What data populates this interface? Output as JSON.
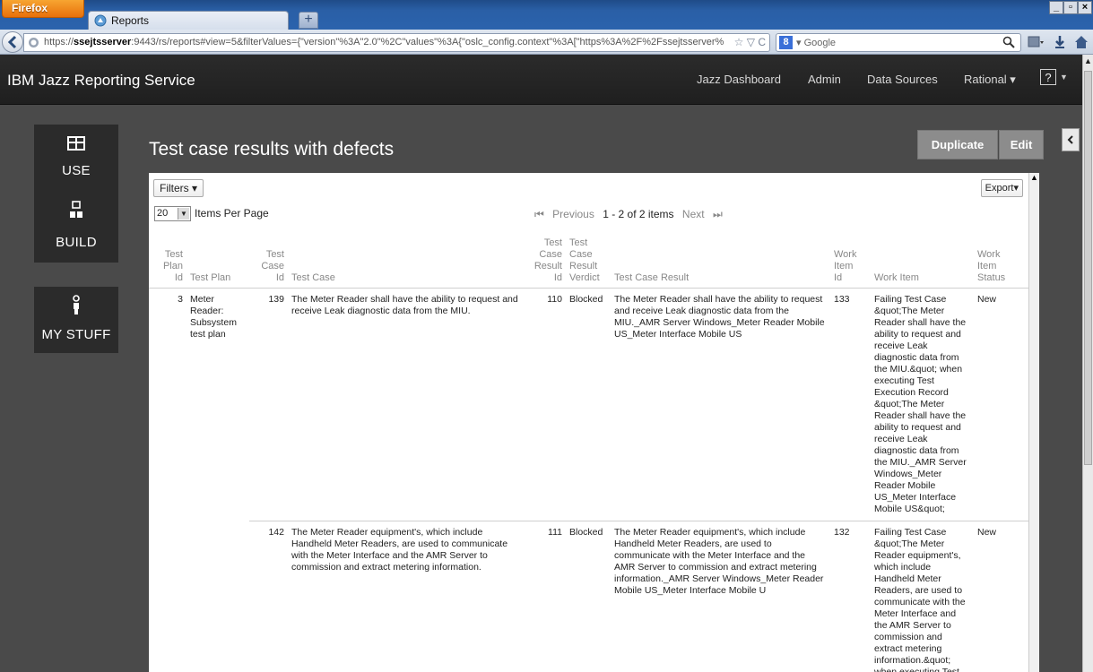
{
  "browser": {
    "menu_button": "Firefox",
    "tab_title": "Reports",
    "new_tab": "+",
    "url_host": "ssejtsserver",
    "url_prefix": "https://",
    "url_rest": ":9443/rs/reports#view=5&filterValues={\"version\"%3A\"2.0\"%2C\"values\"%3A{\"oslc_config.context\"%3A[\"https%3A%2F%2Fssejtsserver%",
    "url_tools": "☆ ▽ C",
    "search_engine_label": "▾ Google",
    "window_controls": [
      "_",
      "▫",
      "×"
    ]
  },
  "header": {
    "app_title": "IBM Jazz Reporting Service",
    "nav": [
      "Jazz Dashboard",
      "Admin",
      "Data Sources",
      "Rational ▾"
    ],
    "help": "?"
  },
  "sidebar": {
    "tiles": [
      {
        "label": "USE",
        "icon": "table-icon"
      },
      {
        "label": "BUILD",
        "icon": "hierarchy-icon"
      },
      {
        "label": "MY STUFF",
        "icon": "person-icon"
      }
    ]
  },
  "main": {
    "title": "Test case results with defects",
    "duplicate_label": "Duplicate",
    "edit_label": "Edit",
    "filters_label": "Filters ▾",
    "export_label": "Export▾",
    "per_page_value": "20",
    "per_page_label": "Items Per Page",
    "pager": {
      "previous": "Previous",
      "count": "1 - 2 of 2 items",
      "next": "Next"
    }
  },
  "table": {
    "headers": {
      "plan_id": [
        "Test",
        "Plan",
        "Id"
      ],
      "plan": "Test Plan",
      "case_id": [
        "Test",
        "Case",
        "Id"
      ],
      "case": "Test Case",
      "result_id": [
        "Test",
        "Case",
        "Result",
        "Id"
      ],
      "verdict": [
        "Test",
        "Case",
        "Result",
        "Verdict"
      ],
      "result": "Test Case Result",
      "wi_id": [
        "Work",
        "Item",
        "Id"
      ],
      "wi": "Work Item",
      "wi_status": [
        "Work",
        "Item",
        "Status"
      ]
    },
    "rows": [
      {
        "plan_id": "3",
        "plan": "Meter Reader: Subsystem test plan",
        "case_id": "139",
        "case": "The Meter Reader shall have the ability to request and receive Leak diagnostic data from the MIU.",
        "result_id": "110",
        "verdict": "Blocked",
        "result": "The Meter Reader shall have the ability to request and receive Leak diagnostic data from the MIU._AMR Server Windows_Meter Reader Mobile US_Meter Interface Mobile US",
        "wi_id": "133",
        "wi": "Failing Test Case &quot;The Meter Reader shall have the ability to request and receive Leak diagnostic data from the MIU.&quot; when executing Test Execution Record &quot;The Meter Reader shall have the ability to request and receive Leak diagnostic data from the MIU._AMR Server Windows_Meter Reader Mobile US_Meter Interface Mobile US&quot;",
        "wi_status": "New"
      },
      {
        "plan_id": "",
        "plan": "",
        "case_id": "142",
        "case": "The Meter Reader equipment's, which include Handheld Meter Readers, are used to communicate with the Meter Interface and the AMR Server to commission and extract metering information.",
        "result_id": "111",
        "verdict": "Blocked",
        "result": "The Meter Reader equipment's, which include Handheld Meter Readers, are used to communicate with the Meter Interface and the AMR Server to commission and extract metering information._AMR Server Windows_Meter Reader Mobile US_Meter Interface Mobile U",
        "wi_id": "132",
        "wi": "Failing Test Case &quot;The Meter Reader equipment's, which include Handheld Meter Readers, are used to communicate with the Meter Interface and the AMR Server to commission and extract metering information.&quot; when executing Test",
        "wi_status": "New"
      }
    ]
  }
}
